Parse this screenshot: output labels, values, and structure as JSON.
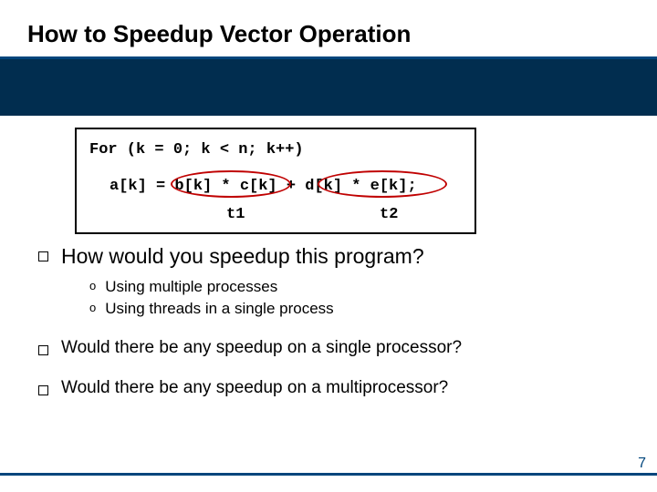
{
  "title": "How to Speedup Vector Operation",
  "code": {
    "line1": "For (k = 0; k < n; k++)",
    "line2": "a[k] = b[k] * c[k] + d[k] * e[k];",
    "t1": "t1",
    "t2": "t2"
  },
  "bullets": {
    "q1": "How would you speedup this program?",
    "sub": [
      "Using multiple processes",
      "Using threads in a single process"
    ],
    "q2": "Would there be any speedup on a single processor?",
    "q3": "Would there be any speedup on a multiprocessor?"
  },
  "page": "7"
}
